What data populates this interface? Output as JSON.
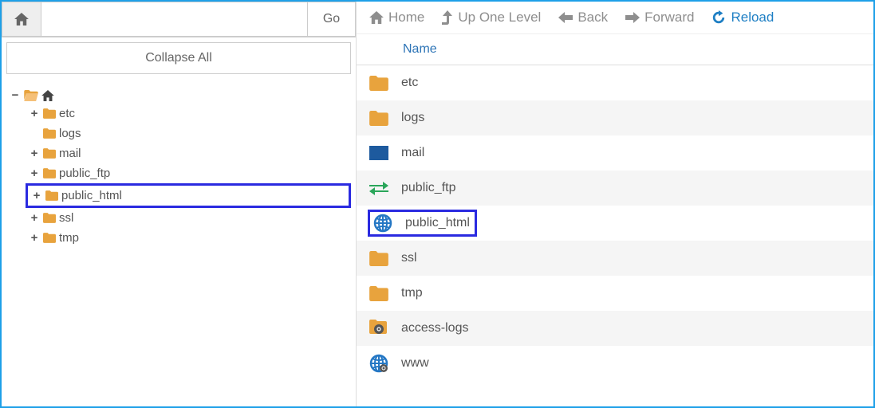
{
  "left": {
    "go_label": "Go",
    "path_value": "",
    "collapse_label": "Collapse All",
    "tree_root_expander": "−",
    "tree_items": [
      {
        "expander": "+",
        "label": "etc",
        "highlight": false
      },
      {
        "expander": "",
        "label": "logs",
        "highlight": false
      },
      {
        "expander": "+",
        "label": "mail",
        "highlight": false
      },
      {
        "expander": "+",
        "label": "public_ftp",
        "highlight": false
      },
      {
        "expander": "+",
        "label": "public_html",
        "highlight": true
      },
      {
        "expander": "+",
        "label": "ssl",
        "highlight": false
      },
      {
        "expander": "+",
        "label": "tmp",
        "highlight": false
      }
    ]
  },
  "toolbar": {
    "home": "Home",
    "up": "Up One Level",
    "back": "Back",
    "forward": "Forward",
    "reload": "Reload"
  },
  "table": {
    "col_name": "Name"
  },
  "rows": [
    {
      "label": "etc",
      "icon": "folder",
      "highlight": false
    },
    {
      "label": "logs",
      "icon": "folder",
      "highlight": false
    },
    {
      "label": "mail",
      "icon": "mail",
      "highlight": false
    },
    {
      "label": "public_ftp",
      "icon": "ftp",
      "highlight": false
    },
    {
      "label": "public_html",
      "icon": "globe",
      "highlight": true
    },
    {
      "label": "ssl",
      "icon": "folder",
      "highlight": false
    },
    {
      "label": "tmp",
      "icon": "folder",
      "highlight": false
    },
    {
      "label": "access-logs",
      "icon": "folder-link",
      "highlight": false
    },
    {
      "label": "www",
      "icon": "globe-link",
      "highlight": false
    }
  ]
}
